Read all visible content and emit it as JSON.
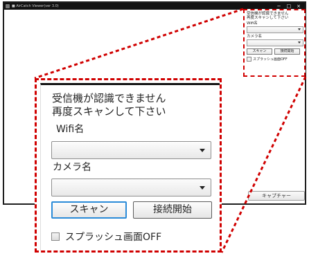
{
  "window": {
    "title": "■ AirCatch Viewer(ver 3.0)",
    "controls": {
      "minimize": "−",
      "maximize": "□",
      "close": "×"
    }
  },
  "capture_button": {
    "label": "キャプチャー"
  },
  "panel": {
    "message": "受信機が認識できません\n再度スキャンして下さい",
    "wifi_label": "Wifi名",
    "wifi_value": "",
    "camera_label": "カメラ名",
    "camera_value": "",
    "scan_button": "スキャン",
    "connect_button": "接続開始",
    "splash_checkbox_label": "スプラッシュ画面OFF",
    "splash_checked": false
  },
  "colors": {
    "callout": "#d00000",
    "focus": "#2a8bd8",
    "titlebar": "#121212"
  },
  "icons": {
    "dropdown": "chevron-down-icon",
    "checkbox": "checkbox-icon"
  }
}
